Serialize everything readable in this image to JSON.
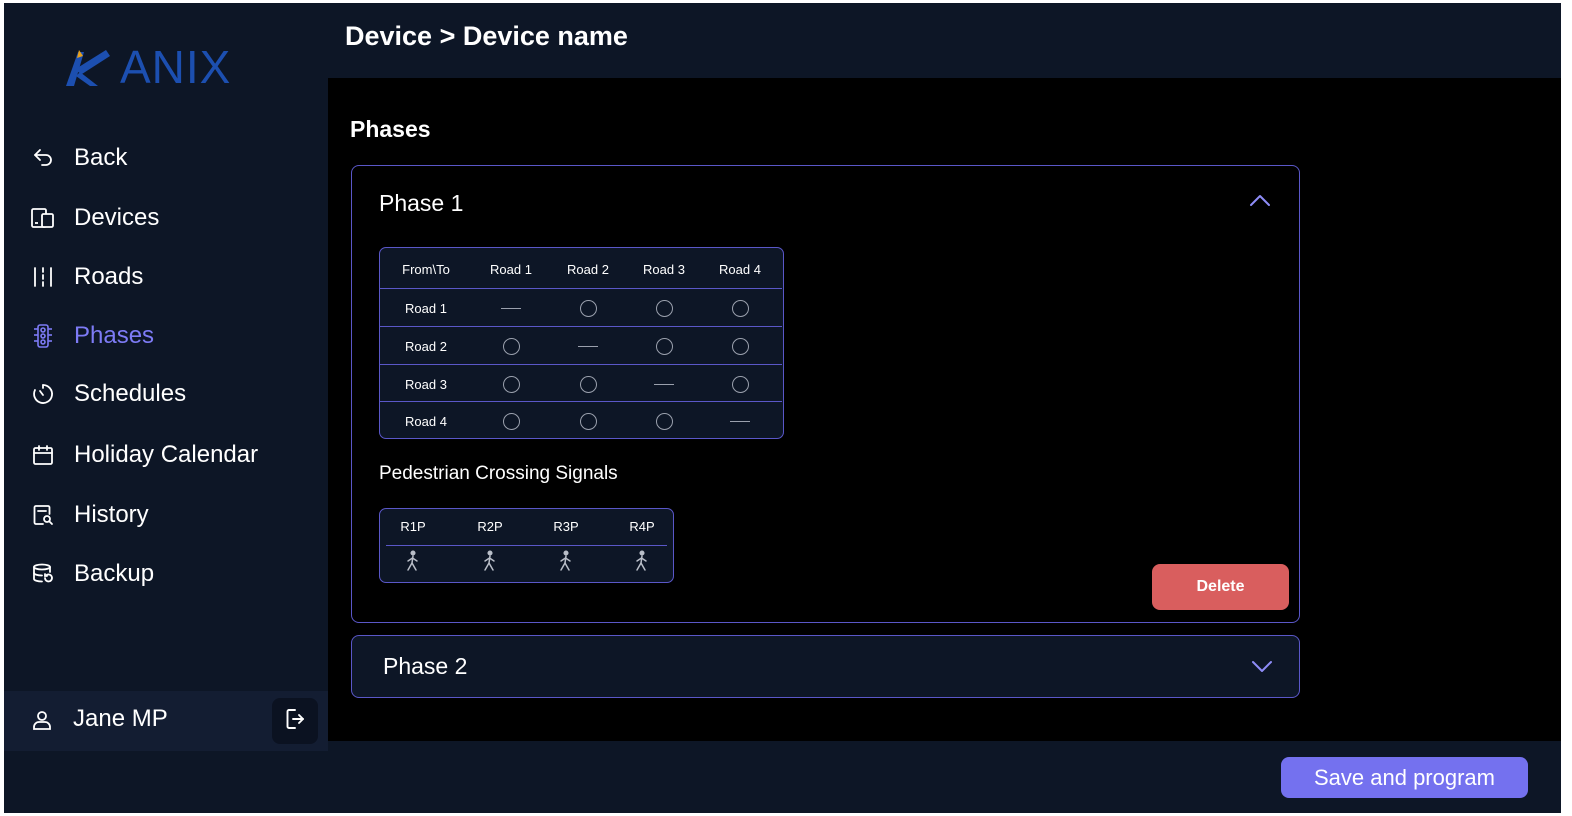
{
  "app": {
    "logo_text": "ANIX",
    "brand_color": "#1c4fb0",
    "accent_color": "#7d7bf5"
  },
  "header": {
    "breadcrumb": "Device > Device name"
  },
  "sidebar": {
    "items": [
      {
        "label": "Back",
        "icon": "undo-icon",
        "active": false
      },
      {
        "label": "Devices",
        "icon": "devices-icon",
        "active": false
      },
      {
        "label": "Roads",
        "icon": "roads-icon",
        "active": false
      },
      {
        "label": "Phases",
        "icon": "traffic-light-icon",
        "active": true
      },
      {
        "label": "Schedules",
        "icon": "timer-icon",
        "active": false
      },
      {
        "label": "Holiday Calendar",
        "icon": "calendar-icon",
        "active": false
      },
      {
        "label": "History",
        "icon": "history-search-icon",
        "active": false
      },
      {
        "label": "Backup",
        "icon": "backup-icon",
        "active": false
      }
    ],
    "user": {
      "name": "Jane MP",
      "icon": "user-icon",
      "logout_icon": "logout-icon"
    }
  },
  "main": {
    "section_title": "Phases",
    "phases": [
      {
        "title": "Phase 1",
        "expanded": true,
        "matrix": {
          "corner": "From\\To",
          "columns": [
            "Road 1",
            "Road 2",
            "Road 3",
            "Road 4"
          ],
          "rows": [
            {
              "label": "Road 1",
              "cells": [
                "dash",
                "circle",
                "circle",
                "circle"
              ]
            },
            {
              "label": "Road 2",
              "cells": [
                "circle",
                "dash",
                "circle",
                "circle"
              ]
            },
            {
              "label": "Road 3",
              "cells": [
                "circle",
                "circle",
                "dash",
                "circle"
              ]
            },
            {
              "label": "Road 4",
              "cells": [
                "circle",
                "circle",
                "circle",
                "dash"
              ]
            }
          ]
        },
        "pedestrian_title": "Pedestrian Crossing Signals",
        "pedestrian": [
          "R1P",
          "R2P",
          "R3P",
          "R4P"
        ],
        "delete_label": "Delete"
      },
      {
        "title": "Phase 2",
        "expanded": false
      }
    ]
  },
  "footer": {
    "save_label": "Save and program"
  }
}
